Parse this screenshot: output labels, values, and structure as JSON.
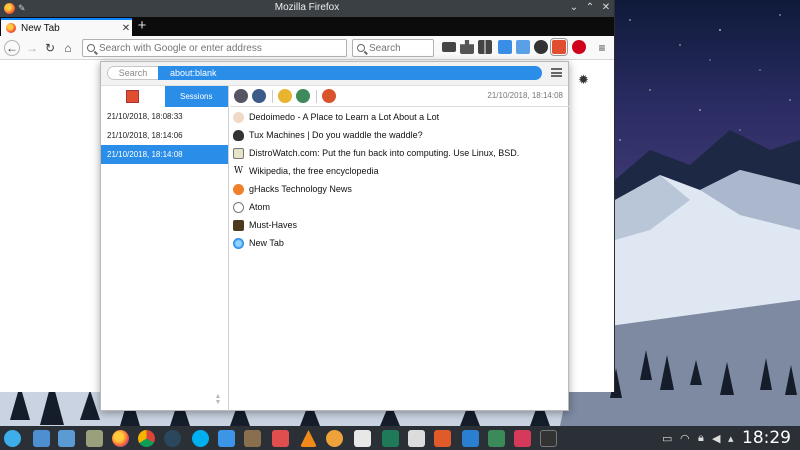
{
  "window": {
    "title": "Mozilla Firefox"
  },
  "tab": {
    "label": "New Tab"
  },
  "urlbar": {
    "placeholder": "Search with Google or enter address"
  },
  "searchbar": {
    "placeholder": "Search"
  },
  "popup": {
    "search_label": "Search",
    "url_value": "about:blank",
    "sessions_tab": "Sessions",
    "selected_date": "21/10/2018, 18:14:08",
    "sessions": [
      {
        "label": "21/10/2018, 18:08:33",
        "selected": false
      },
      {
        "label": "21/10/2018, 18:14:06",
        "selected": false
      },
      {
        "label": "21/10/2018, 18:14:08",
        "selected": true
      }
    ],
    "tabs": [
      {
        "title": "Dedoimedo - A Place to Learn a Lot About a Lot",
        "icon": "dedoimedo-icon"
      },
      {
        "title": "Tux Machines | Do you waddle the waddle?",
        "icon": "tux-icon"
      },
      {
        "title": "DistroWatch.com: Put the fun back into computing. Use Linux, BSD.",
        "icon": "distrowatch-icon"
      },
      {
        "title": "Wikipedia, the free encyclopedia",
        "icon": "wikipedia-icon"
      },
      {
        "title": "gHacks Technology News",
        "icon": "ghacks-icon"
      },
      {
        "title": "Atom",
        "icon": "atom-icon"
      },
      {
        "title": "Must-Haves",
        "icon": "musthaves-icon"
      },
      {
        "title": "New Tab",
        "icon": "firefox-icon"
      }
    ]
  },
  "taskbar": {
    "clock": "18:29"
  },
  "colors": {
    "accent": "#2a8de8",
    "titlebar": "#3b4045",
    "taskbar": "#2b3036"
  }
}
